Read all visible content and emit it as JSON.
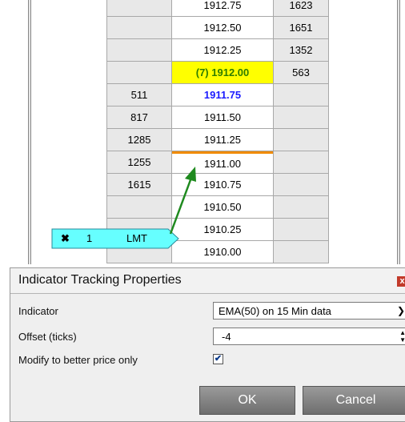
{
  "ladder": {
    "rows": [
      {
        "bid": "",
        "price": "1912.75",
        "ask": "1623",
        "style": ""
      },
      {
        "bid": "",
        "price": "1912.50",
        "ask": "1651",
        "style": ""
      },
      {
        "bid": "",
        "price": "1912.25",
        "ask": "1352",
        "style": ""
      },
      {
        "bid": "",
        "price": "(7) 1912.00",
        "ask": "563",
        "style": "last"
      },
      {
        "bid": "511",
        "price": "1911.75",
        "ask": "",
        "style": "best-bid"
      },
      {
        "bid": "817",
        "price": "1911.50",
        "ask": "",
        "style": ""
      },
      {
        "bid": "1285",
        "price": "1911.25",
        "ask": "",
        "style": ""
      },
      {
        "bid": "1255",
        "price": "1911.00",
        "ask": "",
        "style": "indicator"
      },
      {
        "bid": "1615",
        "price": "1910.75",
        "ask": "",
        "style": ""
      },
      {
        "bid": "",
        "price": "1910.50",
        "ask": "",
        "style": ""
      },
      {
        "bid": "",
        "price": "1910.25",
        "ask": "",
        "style": ""
      },
      {
        "bid": "",
        "price": "1910.00",
        "ask": "",
        "style": ""
      }
    ],
    "colors": {
      "last_bg": "#ffff00",
      "last_fg": "#2e7d00",
      "best_bid_fg": "#1a1aff",
      "indicator_line": "#f08a00",
      "arrow": "#1f8a1f",
      "order_tag": "#66ffff"
    }
  },
  "order": {
    "cancel_icon": "close-icon",
    "cancel_glyph": "✖",
    "quantity": "1",
    "type": "LMT"
  },
  "dialog": {
    "title": "Indicator Tracking Properties",
    "close_glyph": "x",
    "indicator_label": "Indicator",
    "indicator_value": "EMA(50) on 15 Min data",
    "offset_label": "Offset (ticks)",
    "offset_value": "-4",
    "modify_label": "Modify to better price only",
    "modify_checked": true,
    "check_glyph": "✔",
    "ok_label": "OK",
    "cancel_label": "Cancel"
  }
}
